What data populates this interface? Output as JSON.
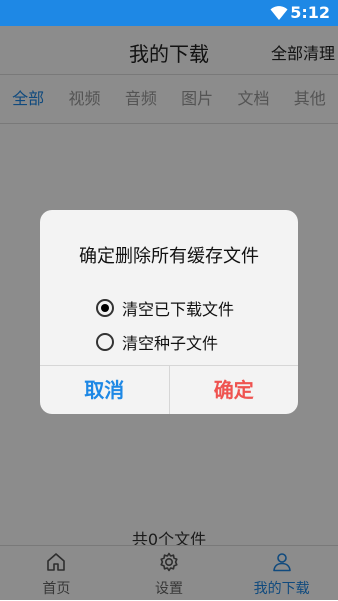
{
  "status_bar": {
    "time": "5:12",
    "wifi_icon": "wifi-icon"
  },
  "header": {
    "title": "我的下载",
    "clear_all": "全部清理"
  },
  "tabs": [
    {
      "label": "全部",
      "active": true
    },
    {
      "label": "视频",
      "active": false
    },
    {
      "label": "音频",
      "active": false
    },
    {
      "label": "图片",
      "active": false
    },
    {
      "label": "文档",
      "active": false
    },
    {
      "label": "其他",
      "active": false
    }
  ],
  "file_count_text": "共0个文件",
  "bottom_nav": [
    {
      "label": "首页",
      "icon": "home-icon",
      "active": false
    },
    {
      "label": "设置",
      "icon": "gear-icon",
      "active": false
    },
    {
      "label": "我的下载",
      "icon": "user-icon",
      "active": true
    }
  ],
  "dialog": {
    "title": "确定删除所有缓存文件",
    "options": [
      {
        "label": "清空已下载文件",
        "checked": true
      },
      {
        "label": "清空种子文件",
        "checked": false
      }
    ],
    "cancel_label": "取消",
    "confirm_label": "确定"
  },
  "colors": {
    "accent": "#1e88e5",
    "danger": "#ef5350"
  }
}
